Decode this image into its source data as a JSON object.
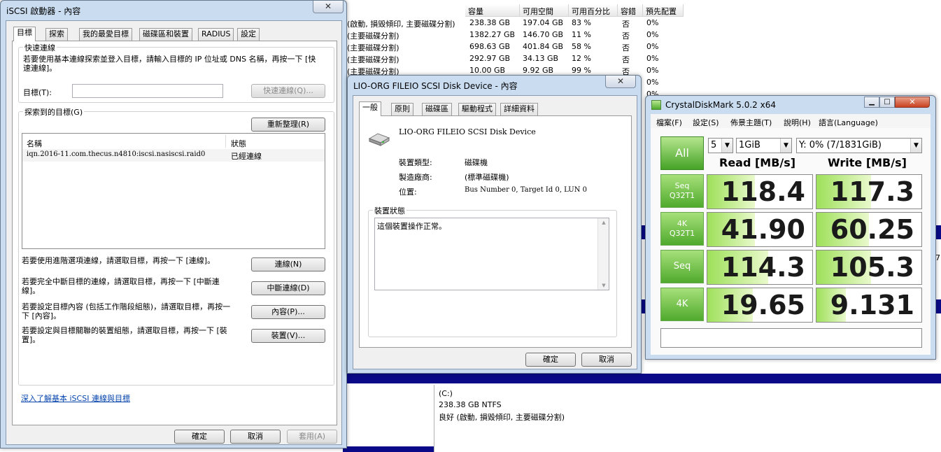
{
  "bg_table": {
    "headers": [
      "容量",
      "可用空間",
      "可用百分比",
      "容錯",
      "預先配置"
    ],
    "rows": [
      {
        "layout": "(啟動, 損毀傾印, 主要磁碟分割)",
        "cap": "238.38 GB",
        "free": "197.04 GB",
        "pct": "83 %",
        "ft": "否",
        "pre": "0%"
      },
      {
        "layout": "(主要磁碟分割)",
        "cap": "1382.27 GB",
        "free": "146.70 GB",
        "pct": "11 %",
        "ft": "否",
        "pre": "0%"
      },
      {
        "layout": "(主要磁碟分割)",
        "cap": "698.63 GB",
        "free": "401.84 GB",
        "pct": "58 %",
        "ft": "否",
        "pre": "0%"
      },
      {
        "layout": "(主要磁碟分割)",
        "cap": "292.97 GB",
        "free": "34.13 GB",
        "pct": "12 %",
        "ft": "否",
        "pre": "0%"
      },
      {
        "layout": "(主要磁碟分割)",
        "cap": "10.00 GB",
        "free": "9.92 GB",
        "pct": "99 %",
        "ft": "否",
        "pre": "0%"
      }
    ],
    "extra_pre": [
      "0%",
      "0%"
    ],
    "side_digit": "7"
  },
  "lower_volume": {
    "name": "(C:)",
    "size": "238.38 GB NTFS",
    "status": "良好 (啟動, 損毀傾印, 主要磁碟分割)"
  },
  "iscsi": {
    "title": "iSCSI 啟動器 - 內容",
    "close": "✕",
    "tabs": [
      "目標",
      "探索",
      "我的最愛目標",
      "磁碟區和裝置",
      "RADIUS",
      "設定"
    ],
    "quick_group": "快速連線",
    "quick_desc": "若要使用基本連線探索並登入目標，請輸入目標的 IP 位址或 DNS 名稱，再按一下 [快速連線]。",
    "target_label": "目標(T):",
    "target_value": "",
    "quick_btn": "快速連線(Q)...",
    "found_group": "探索到的目標(G)",
    "refresh_btn": "重新整理(R)",
    "col_name": "名稱",
    "col_status": "狀態",
    "target_row": {
      "name": "iqn.2016-11.com.thecus.n4810:iscsi.nasiscsi.raid0",
      "status": "已經連線"
    },
    "connect_desc": "若要使用進階選項連線，請選取目標，再按一下 [連線]。",
    "connect_btn": "連線(N)",
    "disconnect_desc": "若要完全中斷目標的連線，請選取目標，再按一下 [中斷連線]。",
    "disconnect_btn": "中斷連線(D)",
    "props_desc": "若要設定目標內容 (包括工作階段組態)，請選取目標，再按一下 [內容]。",
    "props_btn": "內容(P)...",
    "devices_desc": "若要設定與目標關聯的裝置組態，請選取目標，再按一下 [裝置]。",
    "devices_btn": "裝置(V)...",
    "link": "深入了解基本 iSCSI 連線與目標",
    "ok": "確定",
    "cancel": "取消",
    "apply": "套用(A)"
  },
  "device": {
    "title": "LIO-ORG FILEIO SCSI Disk Device - 內容",
    "close": "✕",
    "tabs": [
      "一般",
      "原則",
      "磁碟區",
      "驅動程式",
      "詳細資料"
    ],
    "name": "LIO-ORG FILEIO SCSI Disk Device",
    "type_label": "裝置類型:",
    "type_value": "磁碟機",
    "mfr_label": "製造廠商:",
    "mfr_value": "(標準磁碟機)",
    "loc_label": "位置:",
    "loc_value": "Bus Number 0, Target Id 0, LUN 0",
    "status_group": "裝置狀態",
    "status_text": "這個裝置操作正常。",
    "ok": "確定",
    "cancel": "取消"
  },
  "cdm": {
    "title": "CrystalDiskMark 5.0.2 x64",
    "menu": [
      "檔案(F)",
      "設定(S)",
      "佈景主題(T)",
      "說明(H)",
      "語言(Language)"
    ],
    "all_btn": "All",
    "count": "5",
    "size": "1GiB",
    "drive": "Y: 0% (7/1831GiB)",
    "read_header": "Read [MB/s]",
    "write_header": "Write [MB/s]",
    "rows": [
      {
        "label1": "Seq",
        "label2": "Q32T1",
        "read": "118.4",
        "write": "117.3",
        "read_frac": 0.45,
        "write_frac": 0.52
      },
      {
        "label1": "4K",
        "label2": "Q32T1",
        "read": "41.90",
        "write": "60.25",
        "read_frac": 0.45,
        "write_frac": 0.5
      },
      {
        "label1": "Seq",
        "label2": "",
        "read": "114.3",
        "write": "105.3",
        "read_frac": 0.58,
        "write_frac": 0.52
      },
      {
        "label1": "4K",
        "label2": "",
        "read": "19.65",
        "write": "9.131",
        "read_frac": 0.43,
        "write_frac": 0.28
      }
    ],
    "comment": "",
    "accent": "#4faa2d"
  }
}
